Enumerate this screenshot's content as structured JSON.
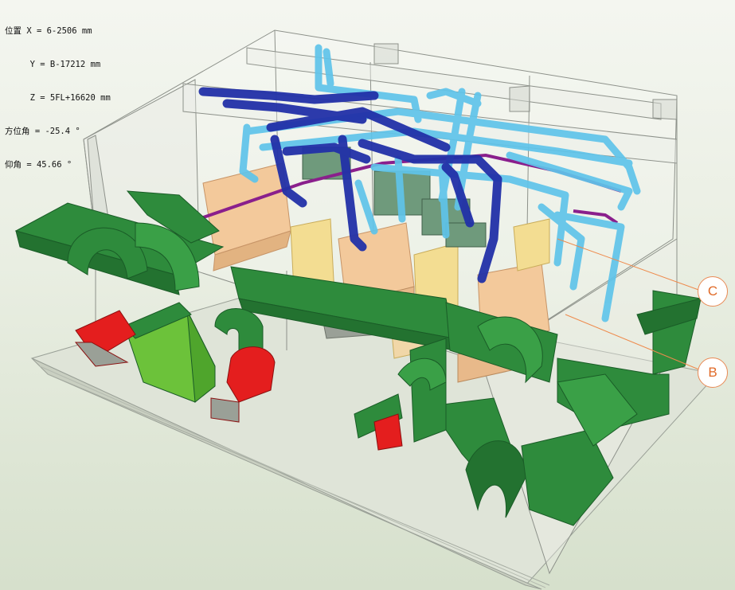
{
  "viewer": {
    "readout": {
      "pos_x_label": "位置 X = ",
      "pos_x_value": "6-2506",
      "pos_x_unit": " mm",
      "pos_y_label": "     Y = ",
      "pos_y_value": "B-17212",
      "pos_y_unit": " mm",
      "pos_z_label": "     Z = ",
      "pos_z_value": "5FL+16620",
      "pos_z_unit": " mm",
      "azimuth_label": "方位角 = ",
      "azimuth_value": "-25.4",
      "azimuth_unit": " °",
      "elevation_label": "仰角 = ",
      "elevation_value": "45.66",
      "elevation_unit": " °"
    },
    "grid_labels": {
      "c": "C",
      "b": "B"
    },
    "colors": {
      "duct_green": "#2e8b3c",
      "duct_green_light": "#6cc23a",
      "fan_red": "#e41e1e",
      "pipe_dark_blue": "#2231a8",
      "pipe_light_blue": "#5fc4ea",
      "pipe_purple": "#8a1f8c",
      "equipment_tan": "#f3c99b",
      "equipment_yellow": "#f3dd92",
      "grid_line": "#ee8a4c"
    }
  }
}
